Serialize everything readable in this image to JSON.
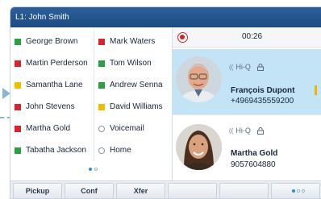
{
  "title_bar": {
    "line_label": "L1: John Smith"
  },
  "blf": {
    "left_column": [
      {
        "name": "George Brown",
        "status_color": "#2e9e45"
      },
      {
        "name": "Martin Perderson",
        "status_color": "#d7252f"
      },
      {
        "name": "Samantha Lane",
        "status_color": "#f0bc00"
      },
      {
        "name": "John Stevens",
        "status_color": "#d7252f"
      },
      {
        "name": "Martha Gold",
        "status_color": "#d7252f"
      },
      {
        "name": "Tabatha Jackson",
        "status_color": "#2e9e45"
      }
    ],
    "right_column": [
      {
        "name": "Mark Waters",
        "status_color": "#d7252f"
      },
      {
        "name": "Tom Wilson",
        "status_color": "#2e9e45"
      },
      {
        "name": "Andrew Senna",
        "status_color": "#2e9e45"
      },
      {
        "name": "David Williams",
        "status_color": "#f0bc00"
      },
      {
        "name": "Voicemail",
        "status_color": "none"
      },
      {
        "name": "Home",
        "status_color": "none"
      }
    ],
    "page_indicator": {
      "current": 1,
      "total": 2
    }
  },
  "call_panel": {
    "recording_icon": "record-icon",
    "timer": "00:26",
    "calls": [
      {
        "state": "active",
        "hd_label": "Hi-Q",
        "name": "François Dupont",
        "number": "+4969435559200"
      },
      {
        "state": "held",
        "hd_label": "Hi-Q",
        "name": "Martha Gold",
        "number": "9057604880"
      }
    ]
  },
  "softkeys": {
    "labels": [
      "Pickup",
      "Conf",
      "Xfer",
      "",
      "",
      ""
    ],
    "page_indicator": {
      "current": 1,
      "total": 3
    }
  },
  "colors": {
    "title_bar": "#1d4b82",
    "active_call": "#c3e4f7",
    "hold_accent": "#f4b400",
    "record": "#d0212c"
  }
}
